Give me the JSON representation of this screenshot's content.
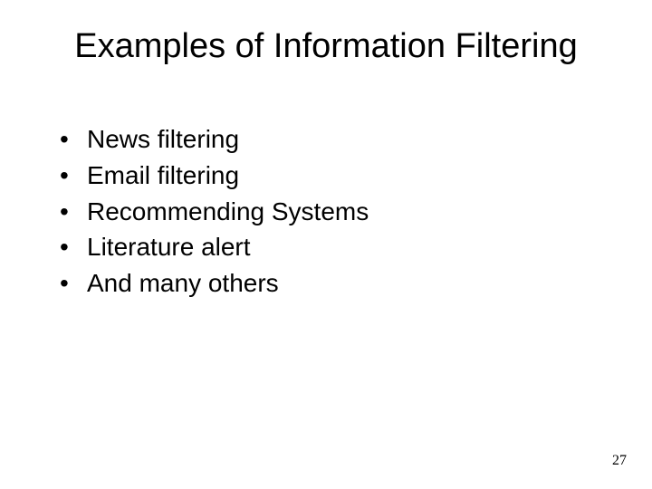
{
  "slide": {
    "title": "Examples of Information Filtering",
    "bullets": [
      "News filtering",
      "Email filtering",
      "Recommending Systems",
      "Literature alert",
      "And many others"
    ],
    "page_number": "27"
  }
}
